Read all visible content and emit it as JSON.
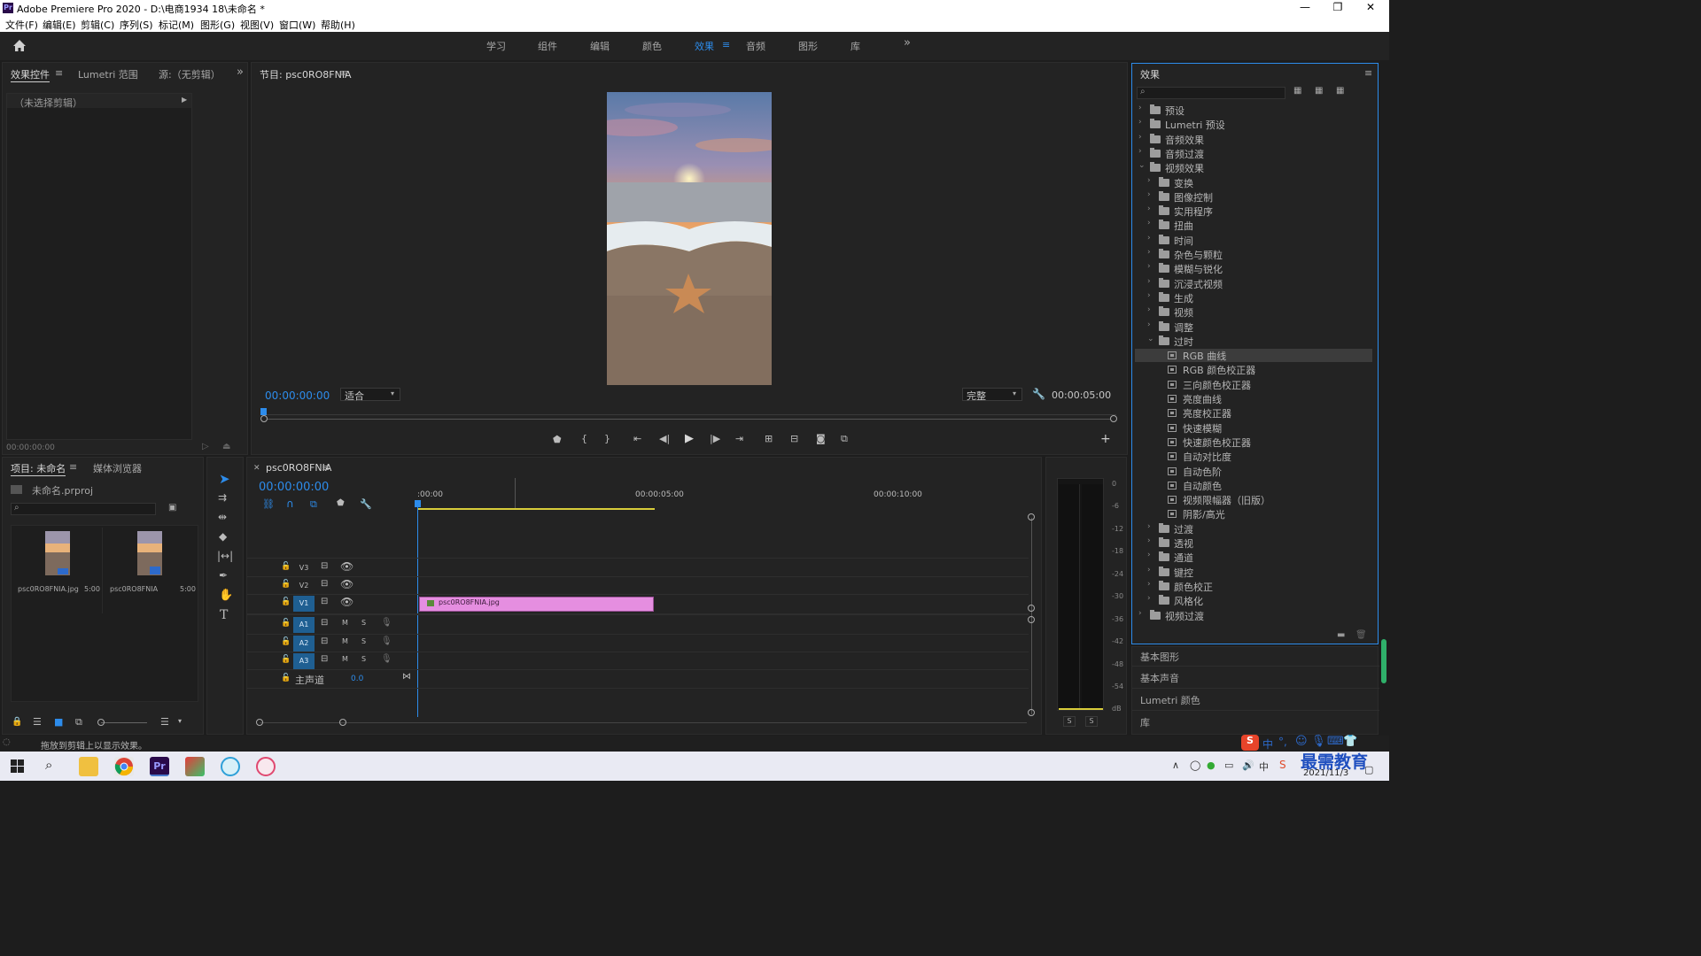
{
  "app": {
    "title": "Adobe Premiere Pro 2020 - D:\\电商1934 18\\未命名 *",
    "logo_text": "Pr",
    "min_glyph": "—",
    "max_glyph": "❐",
    "close_glyph": "✕"
  },
  "menu": [
    "文件(F)",
    "编辑(E)",
    "剪辑(C)",
    "序列(S)",
    "标记(M)",
    "图形(G)",
    "视图(V)",
    "窗口(W)",
    "帮助(H)"
  ],
  "workspaces": {
    "items": [
      "学习",
      "组件",
      "编辑",
      "颜色",
      "效果",
      "音频",
      "图形",
      "库"
    ],
    "active": "效果",
    "more": "»"
  },
  "source_panel": {
    "tabs": [
      "效果控件",
      "Lumetri 范围",
      "源:（无剪辑）"
    ],
    "no_clip": "（未选择剪辑）",
    "timecode": "00:00:00:00"
  },
  "program_monitor": {
    "tab": "节目: psc0RO8FNIA",
    "timecode": "00:00:00:00",
    "fit": "适合",
    "quality": "完整",
    "duration": "00:00:05:00"
  },
  "project_panel": {
    "tabs": [
      "项目: 未命名",
      "媒体浏览器"
    ],
    "project_file": "未命名.prproj",
    "items": [
      {
        "name": "psc0RO8FNIA.jpg",
        "duration": "5:00"
      },
      {
        "name": "psc0RO8FNIA",
        "duration": "5:00"
      }
    ]
  },
  "timeline": {
    "tab": "psc0RO8FNIA",
    "timecode": "00:00:00:00",
    "ruler": [
      ":00:00",
      "00:00:05:00",
      "00:00:10:00"
    ],
    "video_tracks": [
      "V3",
      "V2",
      "V1"
    ],
    "audio_tracks": [
      "A1",
      "A2",
      "A3"
    ],
    "master_label": "主声道",
    "master_value": "0.0",
    "mute_label": "M",
    "solo_label": "S",
    "clip_name": "psc0RO8FNIA.jpg"
  },
  "meter": {
    "scale": [
      "0",
      "-6",
      "-12",
      "-18",
      "-24",
      "-30",
      "-36",
      "-42",
      "-48",
      "-54",
      "dB"
    ],
    "solo_buttons": [
      "S",
      "S"
    ]
  },
  "effects_panel": {
    "title": "效果",
    "tree": [
      {
        "label": "预设",
        "level": 0,
        "type": "folder",
        "open": false
      },
      {
        "label": "Lumetri 预设",
        "level": 0,
        "type": "folder",
        "open": false
      },
      {
        "label": "音频效果",
        "level": 0,
        "type": "folder",
        "open": false
      },
      {
        "label": "音频过渡",
        "level": 0,
        "type": "folder",
        "open": false
      },
      {
        "label": "视频效果",
        "level": 0,
        "type": "folder",
        "open": true
      },
      {
        "label": "变换",
        "level": 1,
        "type": "folder",
        "open": false
      },
      {
        "label": "图像控制",
        "level": 1,
        "type": "folder",
        "open": false
      },
      {
        "label": "实用程序",
        "level": 1,
        "type": "folder",
        "open": false
      },
      {
        "label": "扭曲",
        "level": 1,
        "type": "folder",
        "open": false
      },
      {
        "label": "时间",
        "level": 1,
        "type": "folder",
        "open": false
      },
      {
        "label": "杂色与颗粒",
        "level": 1,
        "type": "folder",
        "open": false
      },
      {
        "label": "模糊与锐化",
        "level": 1,
        "type": "folder",
        "open": false
      },
      {
        "label": "沉浸式视频",
        "level": 1,
        "type": "folder",
        "open": false
      },
      {
        "label": "生成",
        "level": 1,
        "type": "folder",
        "open": false
      },
      {
        "label": "视频",
        "level": 1,
        "type": "folder",
        "open": false
      },
      {
        "label": "调整",
        "level": 1,
        "type": "folder",
        "open": false
      },
      {
        "label": "过时",
        "level": 1,
        "type": "folder",
        "open": true
      },
      {
        "label": "RGB 曲线",
        "level": 2,
        "type": "effect",
        "selected": true
      },
      {
        "label": "RGB 颜色校正器",
        "level": 2,
        "type": "effect"
      },
      {
        "label": "三向颜色校正器",
        "level": 2,
        "type": "effect"
      },
      {
        "label": "亮度曲线",
        "level": 2,
        "type": "effect"
      },
      {
        "label": "亮度校正器",
        "level": 2,
        "type": "effect"
      },
      {
        "label": "快速模糊",
        "level": 2,
        "type": "effect"
      },
      {
        "label": "快速颜色校正器",
        "level": 2,
        "type": "effect"
      },
      {
        "label": "自动对比度",
        "level": 2,
        "type": "effect"
      },
      {
        "label": "自动色阶",
        "level": 2,
        "type": "effect"
      },
      {
        "label": "自动颜色",
        "level": 2,
        "type": "effect"
      },
      {
        "label": "视频限幅器（旧版）",
        "level": 2,
        "type": "effect"
      },
      {
        "label": "阴影/高光",
        "level": 2,
        "type": "effect"
      },
      {
        "label": "过渡",
        "level": 1,
        "type": "folder",
        "open": false
      },
      {
        "label": "透视",
        "level": 1,
        "type": "folder",
        "open": false
      },
      {
        "label": "通道",
        "level": 1,
        "type": "folder",
        "open": false
      },
      {
        "label": "键控",
        "level": 1,
        "type": "folder",
        "open": false
      },
      {
        "label": "颜色校正",
        "level": 1,
        "type": "folder",
        "open": false
      },
      {
        "label": "风格化",
        "level": 1,
        "type": "folder",
        "open": false
      },
      {
        "label": "视频过渡",
        "level": 0,
        "type": "folder",
        "open": false
      }
    ]
  },
  "side_panels": [
    "基本图形",
    "基本声音",
    "Lumetri 颜色",
    "库"
  ],
  "status": {
    "message": "拖放到剪辑上以显示效果。"
  },
  "tray": {
    "ime_items": [
      "中",
      "°,"
    ],
    "watermark": "最需教育",
    "date": "2021/11/3"
  },
  "colors": {
    "accent": "#2d8ceb",
    "clip": "#e58ee0",
    "selected_row": "#3c3c3c"
  }
}
